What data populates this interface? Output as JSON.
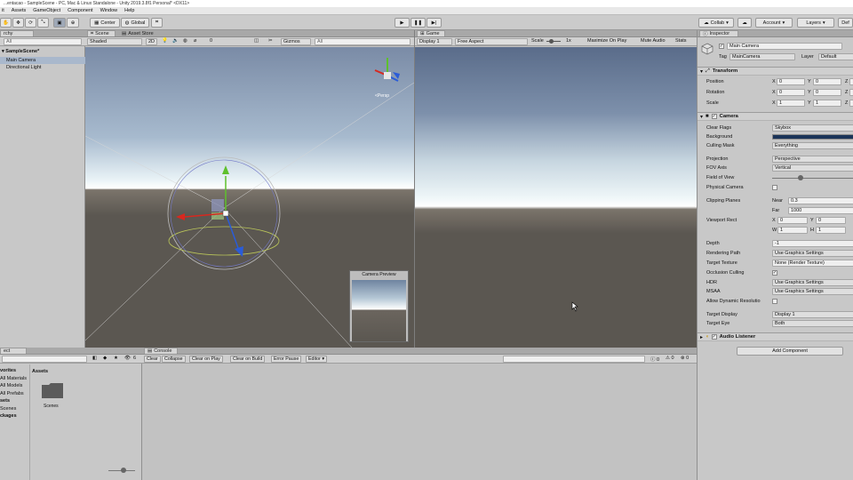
{
  "title": "...entacao - SampleScene - PC, Mac & Linux Standalone - Unity 2019.3.8f1 Personal* <DX11>",
  "menu": [
    "it",
    "Assets",
    "GameObject",
    "Component",
    "Window",
    "Help"
  ],
  "toolbar": {
    "center": "Center",
    "global": "Global",
    "collab": "Collab",
    "account": "Account",
    "layers": "Layers",
    "layout": "Def"
  },
  "hierarchy": {
    "tab": "rchy",
    "search_placeholder": "All",
    "scene": "SampleScene*",
    "items": [
      "Main Camera",
      "Directional Light"
    ]
  },
  "scene_view": {
    "tab_scene": "Scene",
    "tab_asset_store": "Asset Store",
    "shading": "Shaded",
    "mode_2d": "2D",
    "count": "0",
    "gizmos": "Gizmos",
    "search_placeholder": "All",
    "camera_preview": "Camera Preview"
  },
  "game_view": {
    "tab": "Game",
    "display": "Display 1",
    "aspect": "Free Aspect",
    "scale_label": "Scale",
    "scale_value": "1x",
    "maximize": "Maximize On Play",
    "mute": "Mute Audio",
    "stats": "Stats"
  },
  "project": {
    "tab": "ect",
    "count": "6",
    "assets_header": "Assets",
    "tree": [
      {
        "label": "vorites",
        "bold": true
      },
      {
        "label": "All Materials",
        "bold": false
      },
      {
        "label": "All Models",
        "bold": false
      },
      {
        "label": "All Prefabs",
        "bold": false
      },
      {
        "label": "sets",
        "bold": true
      },
      {
        "label": "Scenes",
        "bold": false
      },
      {
        "label": "ckages",
        "bold": true
      }
    ],
    "folder": "Scenes"
  },
  "console": {
    "tab": "Console",
    "buttons": [
      "Clear",
      "Collapse",
      "Clear on Play",
      "Clear on Build",
      "Error Pause",
      "Editor"
    ],
    "counts": [
      "0",
      "0",
      "0"
    ]
  },
  "inspector": {
    "tab": "Inspector",
    "object_name": "Main Camera",
    "static": "",
    "tag_label": "Tag",
    "tag": "MainCamera",
    "layer_label": "Layer",
    "layer": "Default",
    "transform": {
      "title": "Transform",
      "rows": [
        {
          "label": "Position",
          "x": "0",
          "y": "0",
          "z": ""
        },
        {
          "label": "Rotation",
          "x": "0",
          "y": "0",
          "z": ""
        },
        {
          "label": "Scale",
          "x": "1",
          "y": "1",
          "z": ""
        }
      ]
    },
    "camera": {
      "title": "Camera",
      "clear_flags_label": "Clear Flags",
      "clear_flags": "Skybox",
      "background_label": "Background",
      "background_color": "#1b3458",
      "culling_label": "Culling Mask",
      "culling": "Everything",
      "projection_label": "Projection",
      "projection": "Perspective",
      "fov_axis_label": "FOV Axis",
      "fov_axis": "Vertical",
      "fov_label": "Field of View",
      "fov_value": 60,
      "physical_label": "Physical Camera",
      "clipping_label": "Clipping Planes",
      "near_label": "Near",
      "near": "0.3",
      "far_label": "Far",
      "far": "1000",
      "viewport_label": "Viewport Rect",
      "vx": "0",
      "vy": "0",
      "vw": "1",
      "vh": "1",
      "depth_label": "Depth",
      "depth": "-1",
      "render_path_label": "Rendering Path",
      "render_path": "Use Graphics Settings",
      "target_tex_label": "Target Texture",
      "target_tex": "None (Render Texture)",
      "occlusion_label": "Occlusion Culling",
      "hdr_label": "HDR",
      "hdr": "Use Graphics Settings",
      "msaa_label": "MSAA",
      "msaa": "Use Graphics Settings",
      "dyn_res_label": "Allow Dynamic Resolutio",
      "target_display_label": "Target Display",
      "target_display": "Display 1",
      "target_eye_label": "Target Eye",
      "target_eye": "Both"
    },
    "audio_listener": "Audio Listener",
    "add_component": "Add Component"
  },
  "colors": {
    "sky_top": "#6f84a0",
    "sky_horizon": "#ffffff",
    "ground": "#5d5852",
    "axis_x": "#d8281f",
    "axis_y": "#5ec02d",
    "axis_z": "#2a5cd8"
  }
}
